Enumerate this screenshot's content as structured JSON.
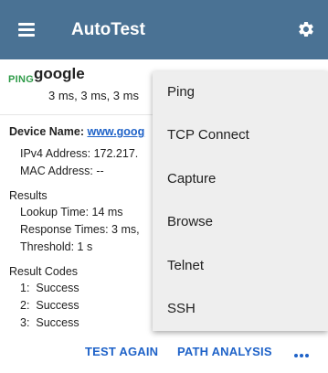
{
  "appbar": {
    "title": "AutoTest",
    "menu_icon": "hamburger-menu-icon",
    "settings_icon": "gear-icon",
    "background": "#4a7294"
  },
  "test": {
    "type_tag": "PING",
    "target": "google",
    "times": "3 ms, 3 ms, 3 ms",
    "device_label": "Device Name:",
    "device_value": "www.goog",
    "ipv4": "IPv4 Address: 172.217.",
    "mac": "MAC Address: --",
    "results_heading": "Results",
    "lookup_time": "Lookup Time: 14 ms",
    "response_times": "Response Times: 3 ms,",
    "threshold": "Threshold: 1 s",
    "result_codes_heading": "Result Codes",
    "codes": [
      "1:  Success",
      "2:  Success",
      "3:  Success"
    ]
  },
  "actions": {
    "test_again": "TEST AGAIN",
    "path_analysis": "PATH ANALYSIS",
    "more_icon": "more-horizontal-icon"
  },
  "overflow_menu": {
    "items": [
      "Ping",
      "TCP Connect",
      "Capture",
      "Browse",
      "Telnet",
      "SSH"
    ]
  },
  "colors": {
    "accent": "#1e62c8",
    "ping_green": "#2e9b48",
    "menu_bg": "#eeeeee"
  }
}
